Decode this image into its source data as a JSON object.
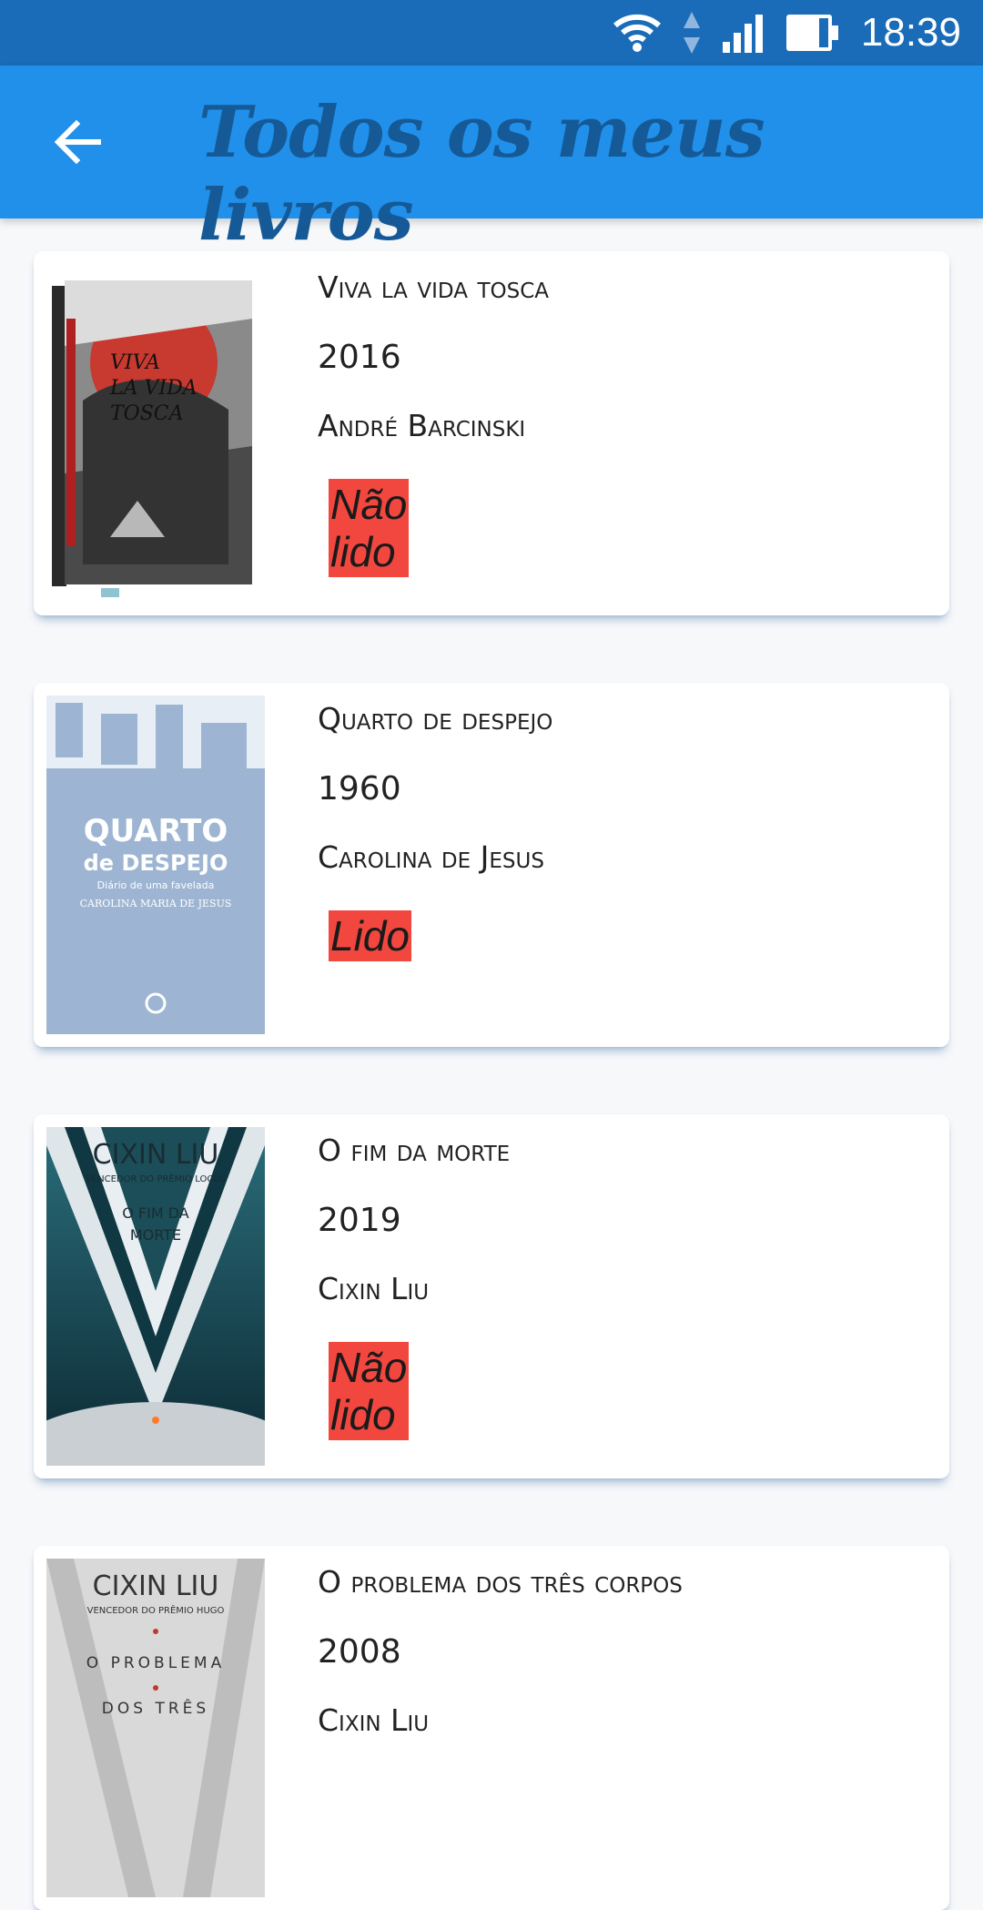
{
  "status_bar": {
    "time": "18:39"
  },
  "app_bar": {
    "title": "Todos os meus livros"
  },
  "books": [
    {
      "title": "Viva la vida tosca",
      "year": "2016",
      "author": "André Barcinski",
      "status": "Não lido",
      "cover_text": "VIVA LA VIDA TOSCA"
    },
    {
      "title": "Quarto de despejo",
      "year": "1960",
      "author": "Carolina de Jesus",
      "status": "Lido",
      "cover_text": [
        "QUARTO",
        "de DESPEJO",
        "Diário de uma favelada",
        "CAROLINA MARIA DE JESUS"
      ]
    },
    {
      "title": "O fim da morte",
      "year": "2019",
      "author": "Cixin Liu",
      "status": "Não lido",
      "cover_text": [
        "CIXIN LIU",
        "VENCEDOR DO PRÊMIO LOCUS",
        "O FIM DA",
        "MORTE"
      ]
    },
    {
      "title": "O problema dos três corpos",
      "year": "2008",
      "author": "Cixin Liu",
      "status": "",
      "cover_text": [
        "CIXIN LIU",
        "VENCEDOR DO PRÊMIO HUGO",
        "O PROBLEMA",
        "DOS TRÊS"
      ]
    }
  ],
  "colors": {
    "status_bar": "#1a6cb8",
    "app_bar": "#2190ea",
    "title": "#155a96",
    "status_badge": "#f2473f"
  }
}
